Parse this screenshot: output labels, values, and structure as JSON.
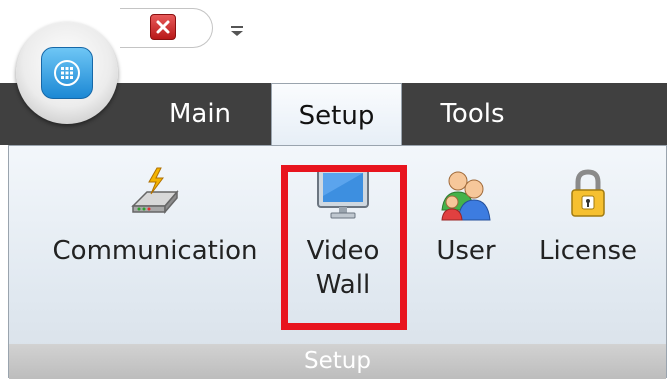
{
  "tabs": [
    {
      "label": "Main"
    },
    {
      "label": "Setup"
    },
    {
      "label": "Tools"
    }
  ],
  "ribbon": {
    "buttons": [
      {
        "label": "Communication",
        "icon": "communication-icon"
      },
      {
        "label": "Video\nWall",
        "icon": "monitor-icon"
      },
      {
        "label": "User",
        "icon": "users-icon"
      },
      {
        "label": "License",
        "icon": "padlock-icon"
      }
    ],
    "group_label": "Setup"
  },
  "colors": {
    "highlight": "#e8141e",
    "tabbar": "#404040",
    "close_button": "#c02020"
  }
}
